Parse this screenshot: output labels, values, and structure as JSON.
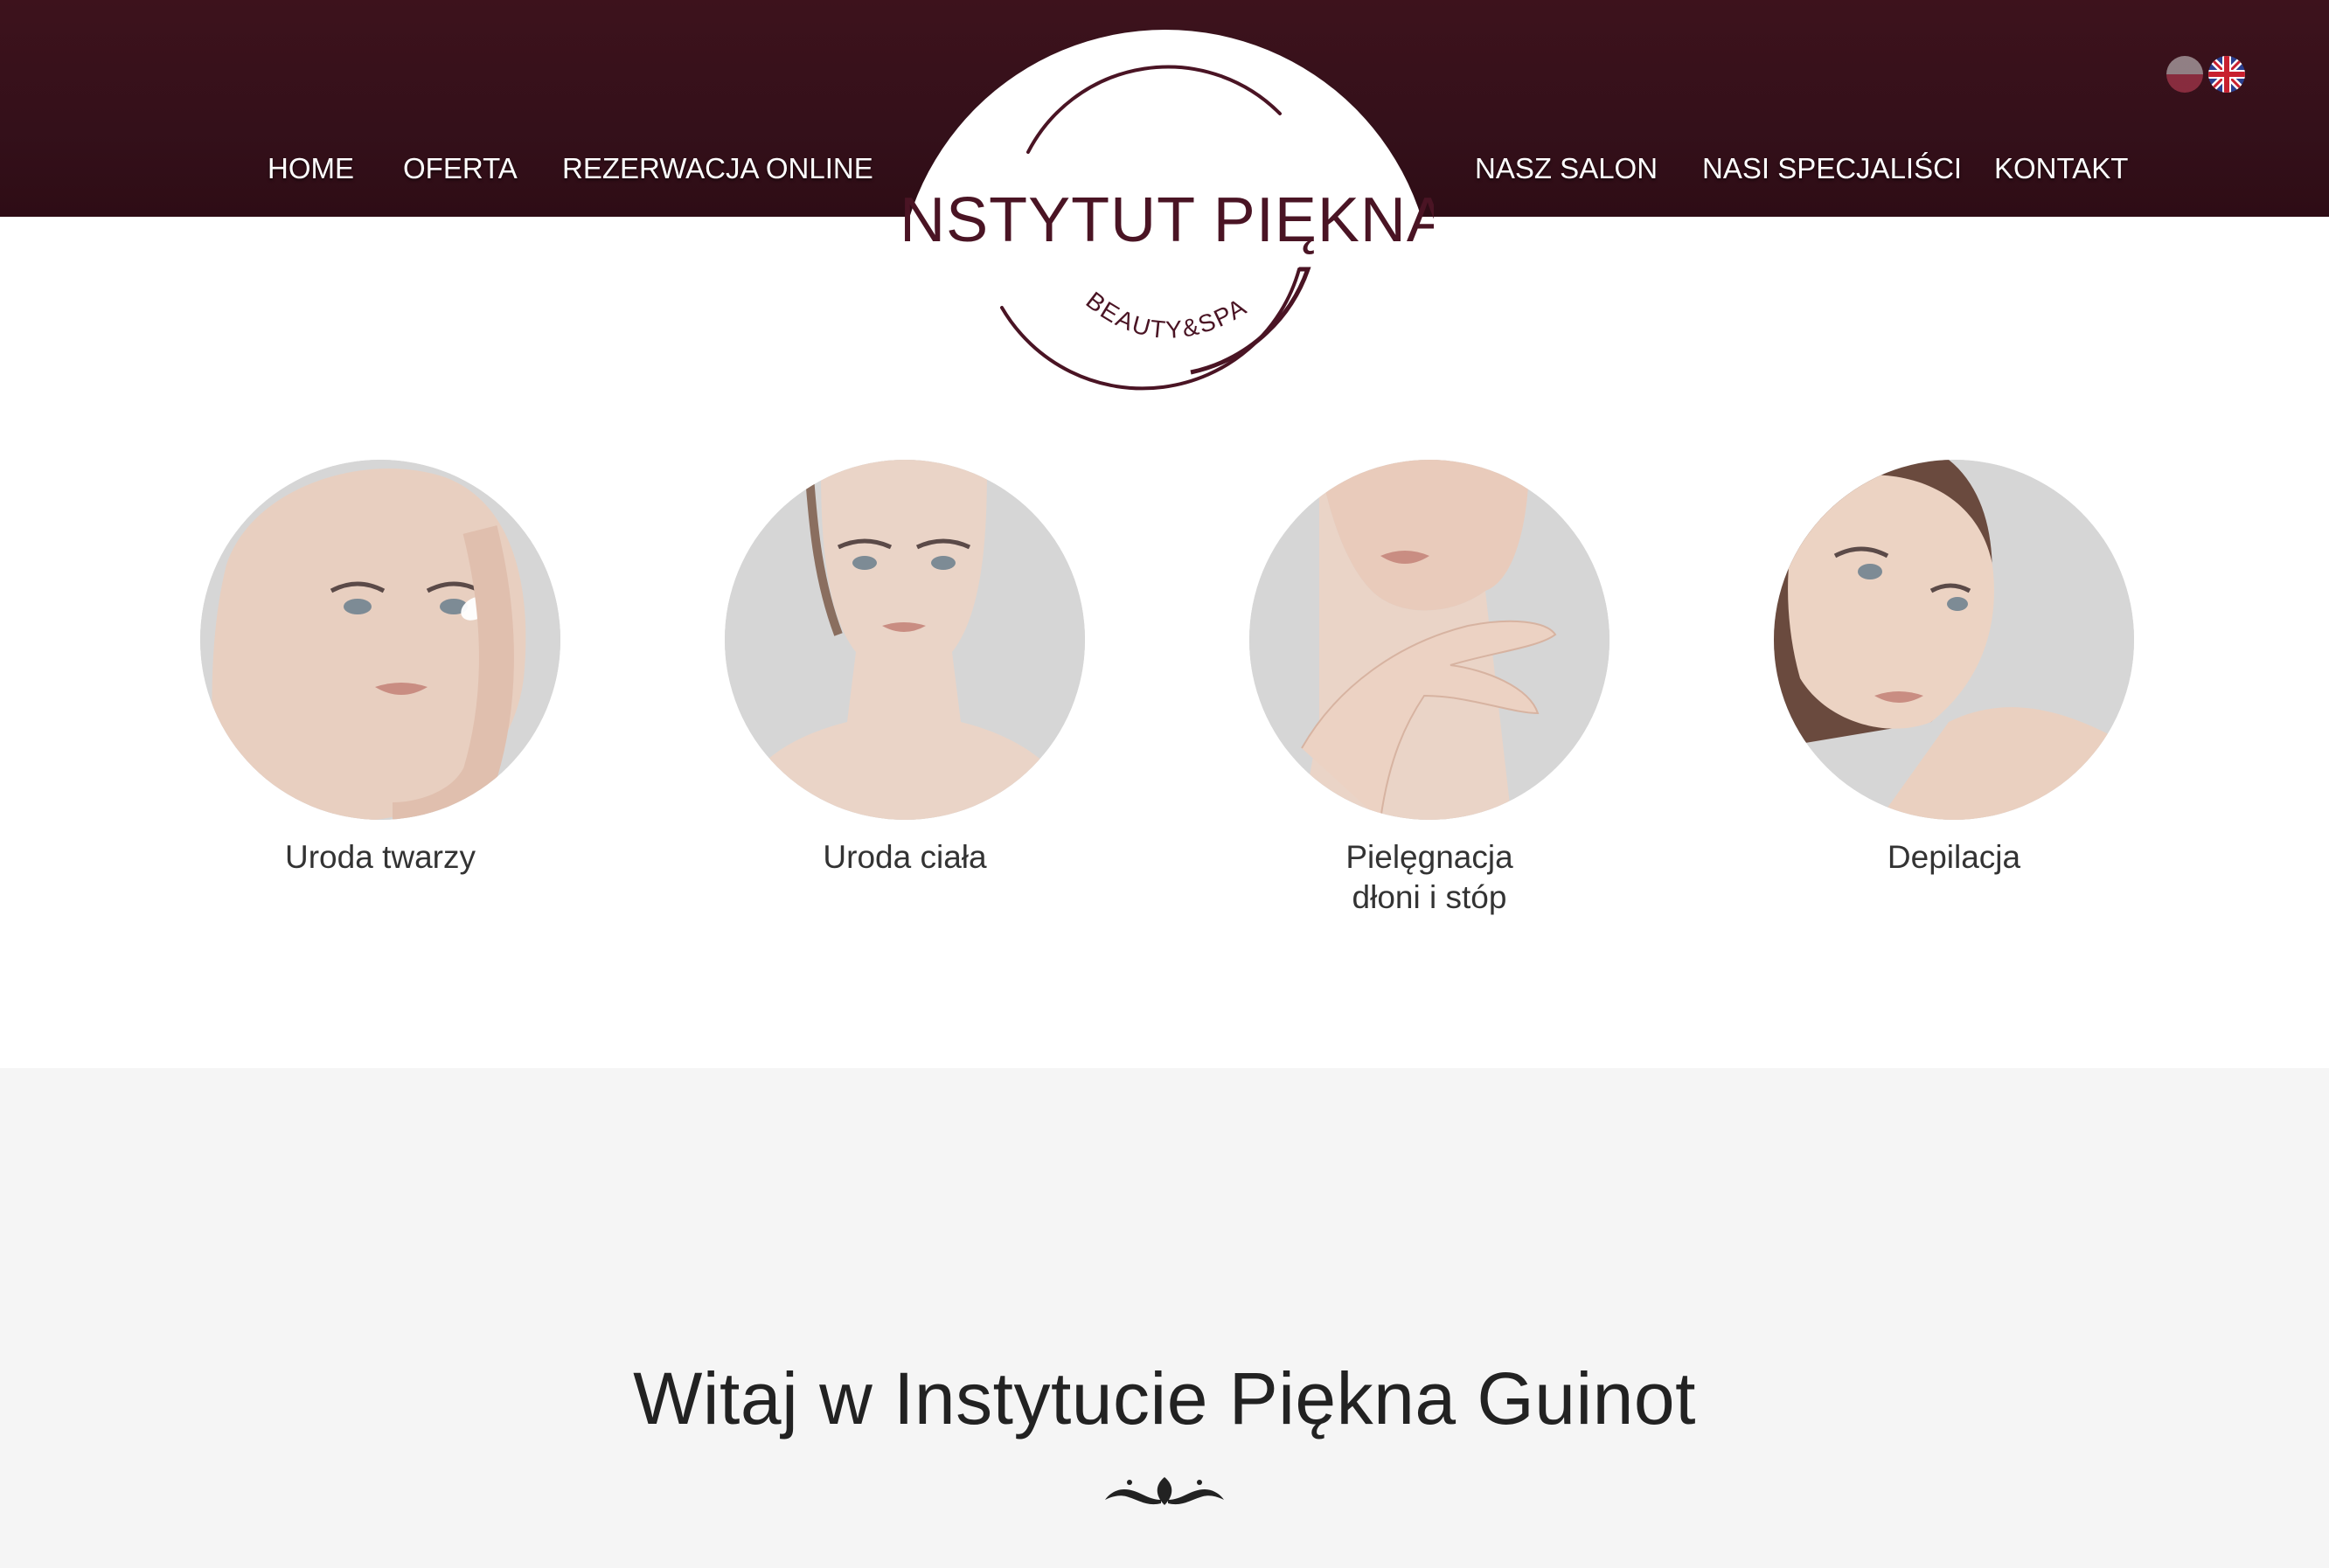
{
  "header": {
    "nav_left": [
      "HOME",
      "OFERTA",
      "REZERWACJA ONLINE"
    ],
    "nav_right": [
      "NASZ SALON",
      "NASI SPECJALIŚCI",
      "KONTAKT"
    ],
    "languages": [
      "polish-flag-icon",
      "uk-flag-icon"
    ],
    "logo": {
      "title": "INSTYTUT PIĘKNA",
      "subtitle": "BEAUTY&SPA"
    },
    "colors": {
      "bar": "#3a0f1a",
      "logo": "#4a1424"
    }
  },
  "services": [
    {
      "label": "Uroda twarzy"
    },
    {
      "label": "Uroda ciała"
    },
    {
      "label": "Pielęgnacja\ndłoni i stóp"
    },
    {
      "label": "Depilacja"
    }
  ],
  "welcome": {
    "title": "Witaj w Instytucie Piękna Guinot"
  }
}
